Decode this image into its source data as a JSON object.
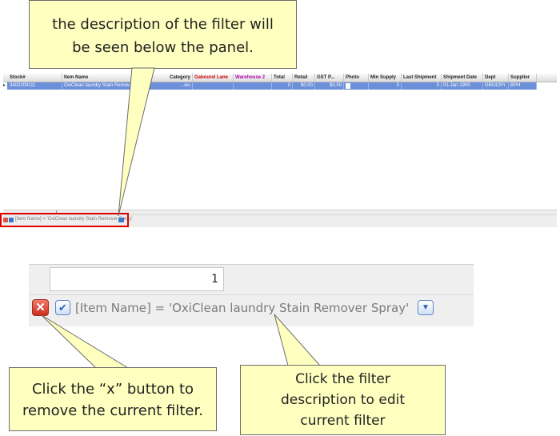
{
  "grid": {
    "columns": [
      "Stock#",
      "Item Name",
      "Category",
      "Gabourel Lane",
      "Warehouse 2",
      "Total",
      "Retail",
      "GST P...",
      "Photo",
      "Min Supply",
      "Last Shipment",
      "Shipment Date",
      "Dept",
      "Supplier"
    ],
    "accent_colors": {
      "gabourel_lane": "#cc0000",
      "warehouse_2": "#b000b0",
      "selection": "#6b8fd8"
    },
    "row": {
      "indicator": "▸",
      "stock": "3402209111",
      "item_name": "OxiClean laundry Stain Remover",
      "category": "...ies",
      "total": "0",
      "retail": "$0.00",
      "gst": "$0.00",
      "min_supply": "0",
      "last_shipment": "0",
      "shipment_date": "01-Jan-1900",
      "dept": "GROCRY",
      "supplier": "BPH"
    }
  },
  "filter": {
    "expression": "[Item Name] = 'OxiClean laundry Stain Remover Spray'",
    "close_icon": "close-x-icon",
    "check_icon": "checkbox-icon",
    "dropdown_icon": "chevron-down-icon"
  },
  "zoom": {
    "input_value": "1"
  },
  "callouts": {
    "top_line1": "the description of the filter will",
    "top_line2": "be seen below the panel.",
    "left_line1": "Click the “x” button to",
    "left_line2": "remove the current filter.",
    "right_line1": "Click the filter",
    "right_line2": "description to edit",
    "right_line3": "current filter"
  }
}
